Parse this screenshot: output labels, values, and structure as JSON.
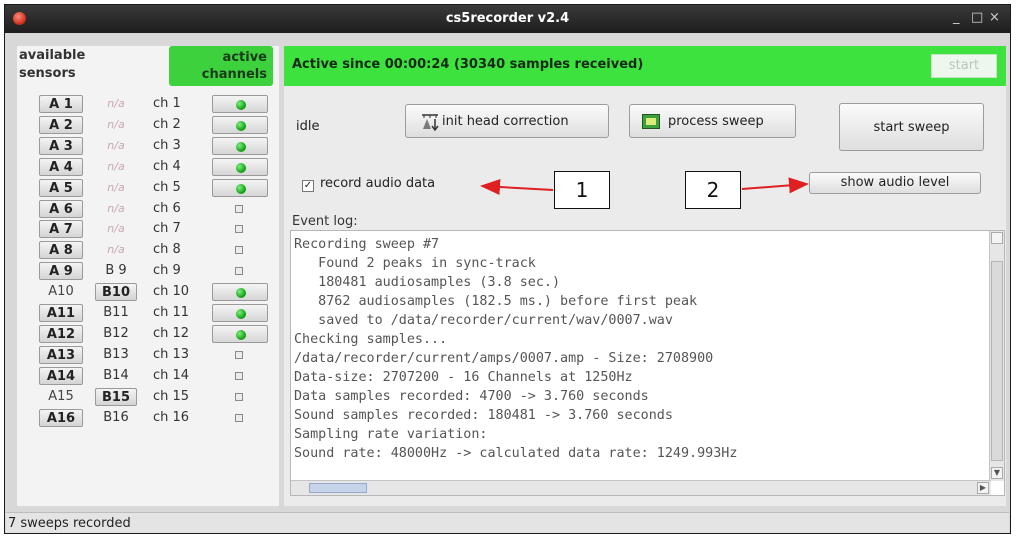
{
  "window": {
    "title": "cs5recorder v2.4",
    "minimize": "_",
    "maximize": "□",
    "close": "×"
  },
  "sidebar": {
    "available_header": "available sensors",
    "active_header": "active channels",
    "rows": [
      {
        "a": "A 1",
        "a_boxed": true,
        "b": "n/a",
        "b_style": "na",
        "ch": "ch 1",
        "active": true
      },
      {
        "a": "A 2",
        "a_boxed": true,
        "b": "n/a",
        "b_style": "na",
        "ch": "ch 2",
        "active": true
      },
      {
        "a": "A 3",
        "a_boxed": true,
        "b": "n/a",
        "b_style": "na",
        "ch": "ch 3",
        "active": true
      },
      {
        "a": "A 4",
        "a_boxed": true,
        "b": "n/a",
        "b_style": "na",
        "ch": "ch 4",
        "active": true
      },
      {
        "a": "A 5",
        "a_boxed": true,
        "b": "n/a",
        "b_style": "na",
        "ch": "ch 5",
        "active": true
      },
      {
        "a": "A 6",
        "a_boxed": true,
        "b": "n/a",
        "b_style": "na",
        "ch": "ch 6",
        "active": false
      },
      {
        "a": "A 7",
        "a_boxed": true,
        "b": "n/a",
        "b_style": "na",
        "ch": "ch 7",
        "active": false
      },
      {
        "a": "A 8",
        "a_boxed": true,
        "b": "n/a",
        "b_style": "na",
        "ch": "ch 8",
        "active": false
      },
      {
        "a": "A 9",
        "a_boxed": true,
        "b": "B 9",
        "b_style": "plain",
        "ch": "ch 9",
        "active": false
      },
      {
        "a": "A10",
        "a_boxed": false,
        "b": "B10",
        "b_style": "boxed",
        "ch": "ch 10",
        "active": true
      },
      {
        "a": "A11",
        "a_boxed": true,
        "b": "B11",
        "b_style": "plain",
        "ch": "ch 11",
        "active": true
      },
      {
        "a": "A12",
        "a_boxed": true,
        "b": "B12",
        "b_style": "plain",
        "ch": "ch 12",
        "active": true
      },
      {
        "a": "A13",
        "a_boxed": true,
        "b": "B13",
        "b_style": "plain",
        "ch": "ch 13",
        "active": false
      },
      {
        "a": "A14",
        "a_boxed": true,
        "b": "B14",
        "b_style": "plain",
        "ch": "ch 14",
        "active": false
      },
      {
        "a": "A15",
        "a_boxed": false,
        "b": "B15",
        "b_style": "boxed",
        "ch": "ch 15",
        "active": false
      },
      {
        "a": "A16",
        "a_boxed": true,
        "b": "B16",
        "b_style": "plain",
        "ch": "ch 16",
        "active": false
      }
    ]
  },
  "main": {
    "status_banner": "Active since 00:00:24 (30340 samples received)",
    "start_small_label": "start",
    "state_label": "idle",
    "init_head_label": "init head correction",
    "process_sweep_label": "process sweep",
    "start_sweep_label": "start sweep",
    "record_audio_label": "record audio data",
    "record_audio_checked": true,
    "show_audio_label": "show audio level",
    "event_log_label": "Event log:",
    "log_lines": [
      "Recording sweep #7",
      "   Found 2 peaks in sync-track",
      "   180481 audiosamples (3.8 sec.)",
      "   8762 audiosamples (182.5 ms.) before first peak",
      "   saved to /data/recorder/current/wav/0007.wav",
      "Checking samples...",
      "/data/recorder/current/amps/0007.amp - Size: 2708900",
      "Data-size: 2707200 - 16 Channels at 1250Hz",
      "Data samples recorded: 4700 -> 3.760 seconds",
      "Sound samples recorded: 180481 -> 3.760 seconds",
      "Sampling rate variation:",
      "Sound rate: 48000Hz -> calculated data rate: 1249.993Hz"
    ]
  },
  "annotations": {
    "callout_1": "1",
    "callout_2": "2",
    "arrow_color": "#e02020"
  },
  "statusbar": {
    "text": "7 sweeps recorded"
  },
  "colors": {
    "active_green": "#3ee23e",
    "header_green": "#3dd23d",
    "led_green": "#0e9a0e"
  }
}
